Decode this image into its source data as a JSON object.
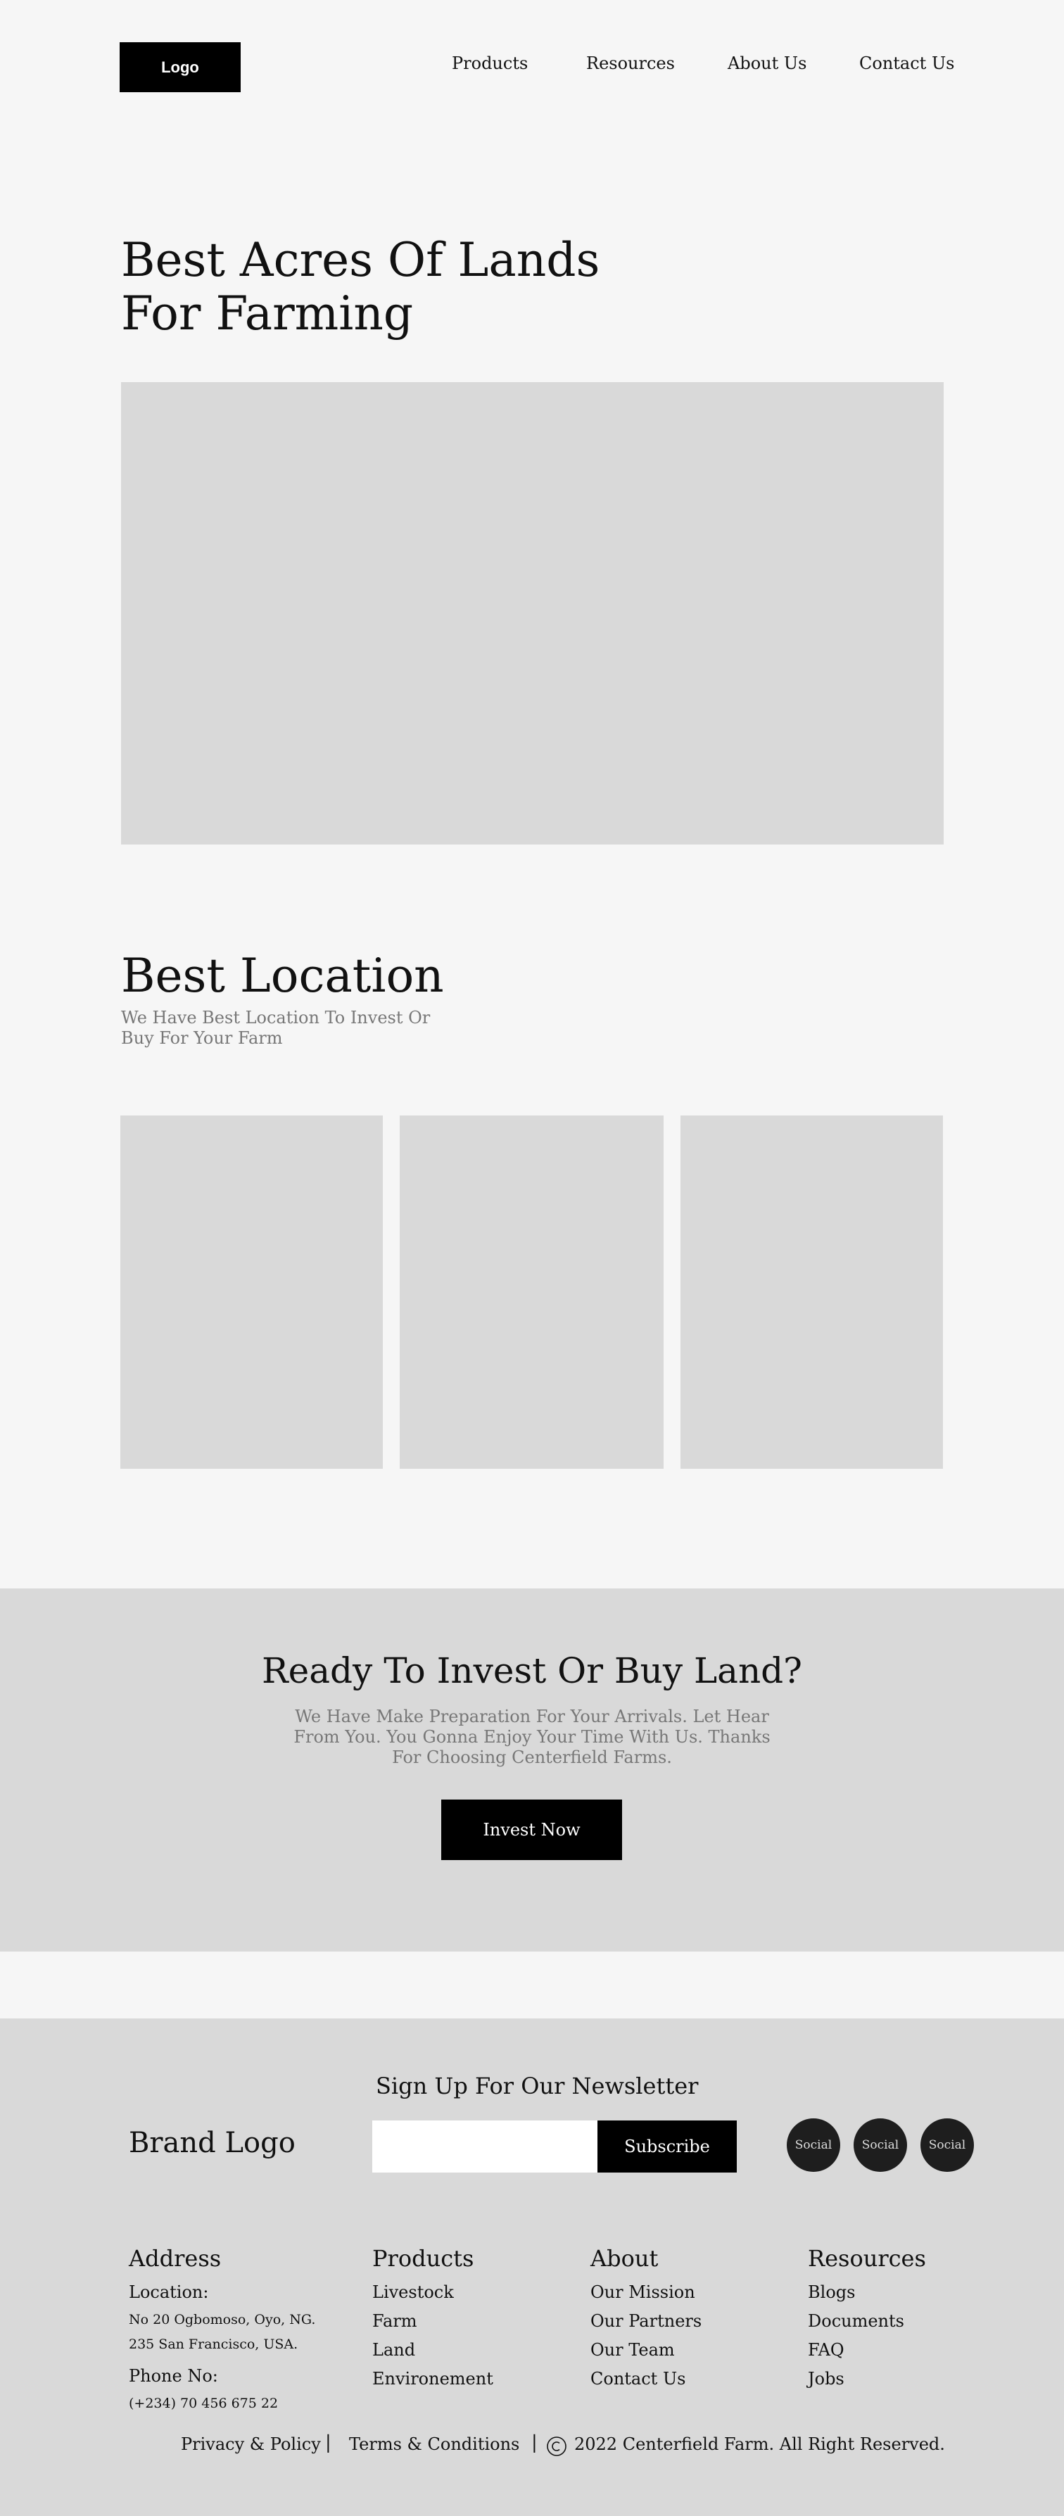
{
  "header": {
    "logo": "Logo",
    "nav": [
      "Products",
      "Resources",
      "About Us",
      "Contact Us"
    ]
  },
  "hero": {
    "title": "Best Acres Of Lands For Farming"
  },
  "location": {
    "title": "Best Location",
    "subtitle": "We Have Best Location To Invest Or Buy For Your Farm"
  },
  "cta": {
    "title": "Ready To Invest Or Buy Land?",
    "subtitle": "We Have Make Preparation For Your Arrivals. Let Hear From You. You Gonna Enjoy Your Time With Us. Thanks For Choosing Centerfield Farms.",
    "button": "Invest Now"
  },
  "footer": {
    "newsletter_title": "Sign Up For Our Newsletter",
    "brand": "Brand Logo",
    "email_value": "",
    "subscribe": "Subscribe",
    "socials": [
      "Social",
      "Social",
      "Social"
    ],
    "address": {
      "heading": "Address",
      "location_label": "Location:",
      "line1": "No 20 Ogbomoso, Oyo, NG.",
      "line2": "235 San Francisco, USA.",
      "phone_label": "Phone No:",
      "phone": "(+234) 70 456 675 22"
    },
    "products": {
      "heading": "Products",
      "items": [
        "Livestock",
        "Farm",
        "Land",
        "Environement"
      ]
    },
    "about": {
      "heading": "About",
      "items": [
        "Our Mission",
        "Our Partners",
        "Our Team",
        "Contact Us"
      ]
    },
    "resources": {
      "heading": "Resources",
      "items": [
        "Blogs",
        "Documents",
        "FAQ",
        "Jobs"
      ]
    },
    "bottom": {
      "privacy": "Privacy & Policy",
      "terms": "Terms & Conditions",
      "copyright": "2022 Centerfield Farm. All Right Reserved.",
      "separator": "|"
    }
  }
}
